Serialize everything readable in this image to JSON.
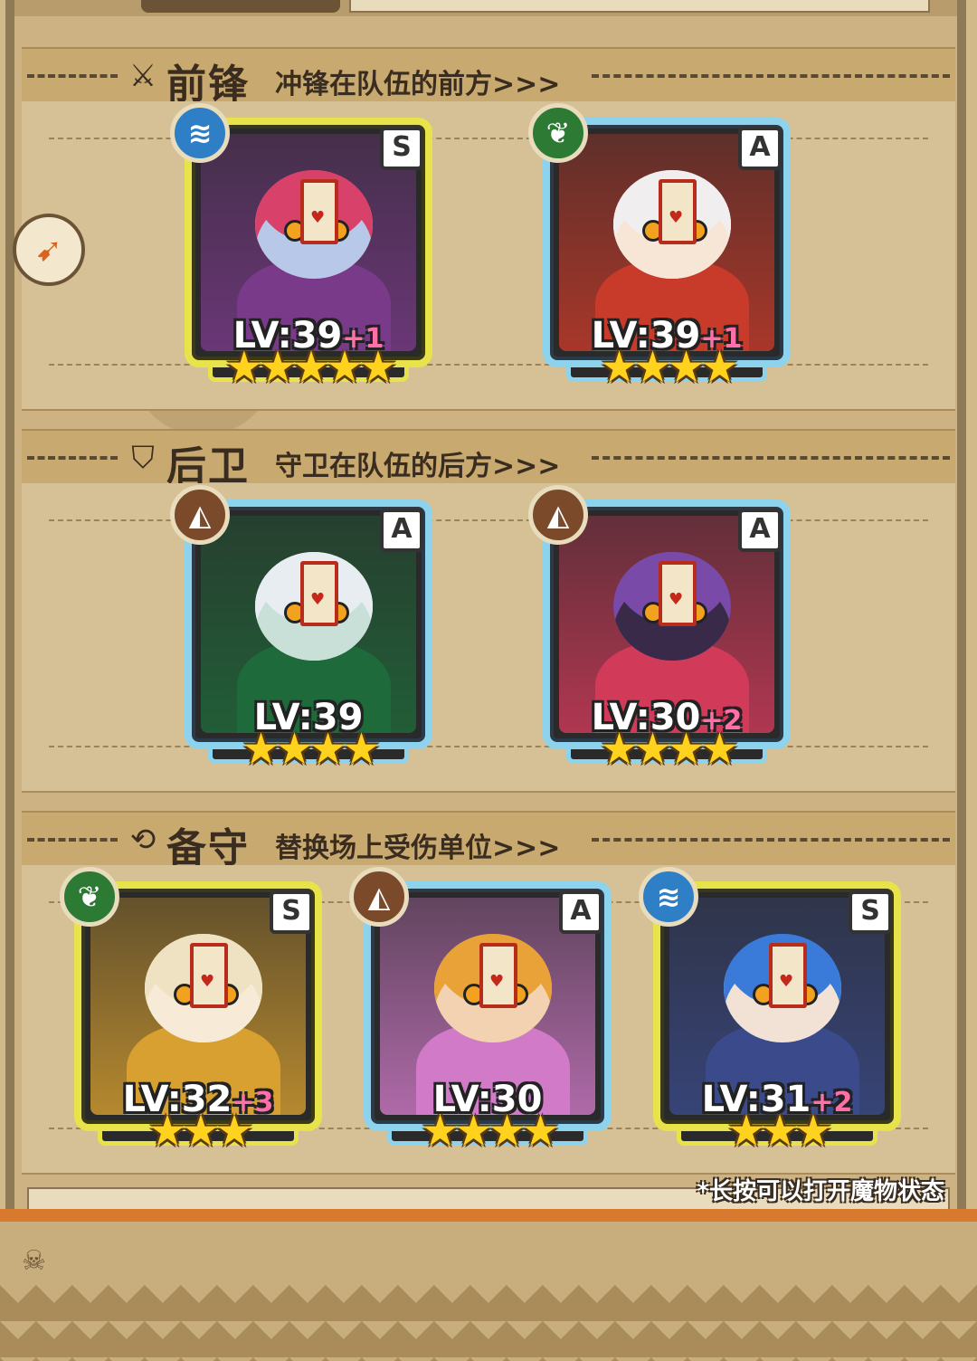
{
  "sections": [
    {
      "title": "前锋",
      "subtitle": "冲锋在队伍的前方>>>",
      "icon": "sword-icon",
      "icon_glyph": "⚔"
    },
    {
      "title": "后卫",
      "subtitle": "守卫在队伍的后方>>>",
      "icon": "shield-icon",
      "icon_glyph": "⛉"
    },
    {
      "title": "备守",
      "subtitle": "替换场上受伤单位>>>",
      "icon": "swap-icon",
      "icon_glyph": "⟲"
    }
  ],
  "cards": [
    {
      "rank": "S",
      "element": "water-icon",
      "element_glyph": "≋",
      "level": "LV:39",
      "plus": "+1",
      "stars": "★★★★★",
      "star_count": 5,
      "hair": "#d8426a",
      "skin": "#b7c8e8",
      "outfit": "#7a3a8a"
    },
    {
      "rank": "A",
      "element": "leaf-icon",
      "element_glyph": "❦",
      "level": "LV:39",
      "plus": "+1",
      "stars": "★★★★",
      "star_count": 4,
      "hair": "#f1eef0",
      "skin": "#f7e6d6",
      "outfit": "#c83a2a"
    },
    {
      "rank": "A",
      "element": "mountain-icon",
      "element_glyph": "◭",
      "level": "LV:39",
      "plus": "",
      "stars": "★★★★",
      "star_count": 4,
      "hair": "#e8edf2",
      "skin": "#c8e0d8",
      "outfit": "#1f6a3a"
    },
    {
      "rank": "A",
      "element": "mountain-icon",
      "element_glyph": "◭",
      "level": "LV:30",
      "plus": "+2",
      "stars": "★★★★",
      "star_count": 4,
      "hair": "#7a4aa8",
      "skin": "#3a2a4a",
      "outfit": "#d23a5a"
    },
    {
      "rank": "S",
      "element": "leaf-icon",
      "element_glyph": "❦",
      "level": "LV:32",
      "plus": "+3",
      "stars": "★★★",
      "star_count": 3,
      "hair": "#efe2c2",
      "skin": "#f7ead6",
      "outfit": "#d8a030"
    },
    {
      "rank": "A",
      "element": "mountain-icon",
      "element_glyph": "◭",
      "level": "LV:30",
      "plus": "",
      "stars": "★★★★",
      "star_count": 4,
      "hair": "#e8a238",
      "skin": "#f2d2b0",
      "outfit": "#d07ac8"
    },
    {
      "rank": "S",
      "element": "water-icon",
      "element_glyph": "≋",
      "level": "LV:31",
      "plus": "+2",
      "stars": "★★★",
      "star_count": 3,
      "hair": "#3a7ad8",
      "skin": "#f2e2d6",
      "outfit": "#3a4a8a"
    }
  ],
  "hint": "*长按可以打开魔物状态",
  "side_button": "back-arrow-icon"
}
